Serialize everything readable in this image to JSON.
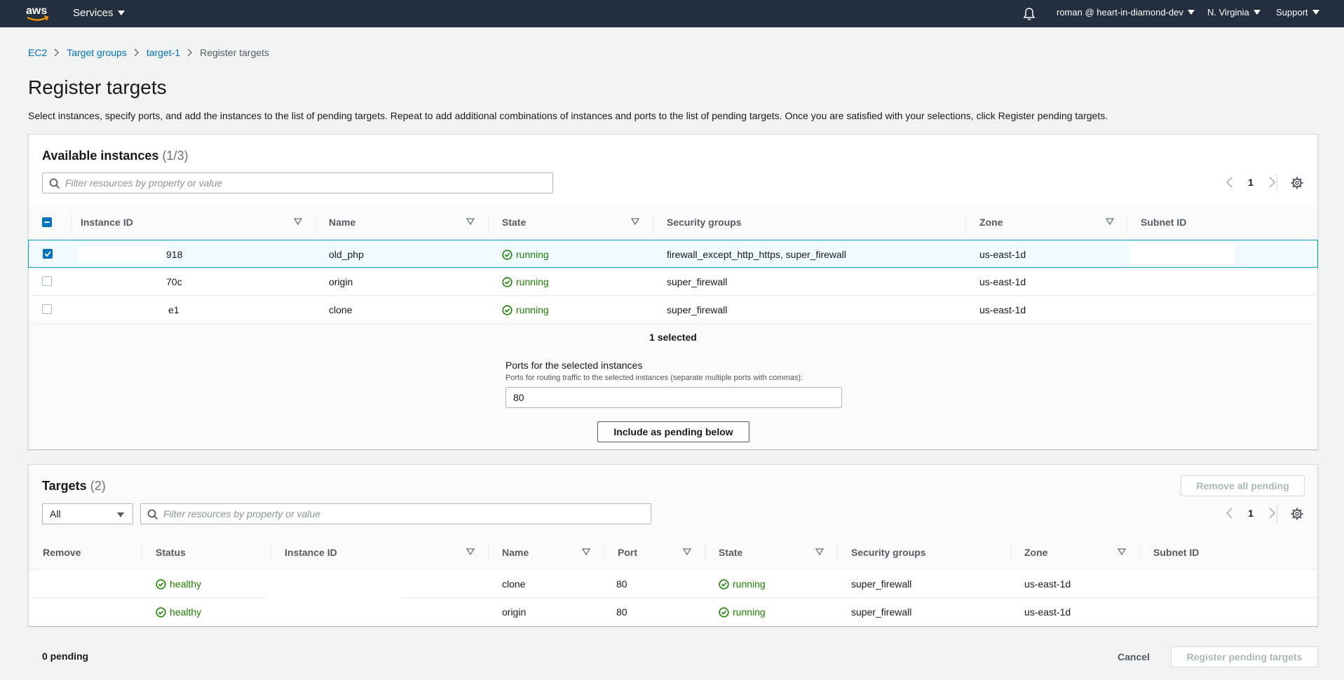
{
  "nav": {
    "services": "Services",
    "account": "roman @ heart-in-diamond-dev",
    "region": "N. Virginia",
    "support": "Support"
  },
  "breadcrumb": [
    "EC2",
    "Target groups",
    "target-1",
    "Register targets"
  ],
  "page": {
    "title": "Register targets",
    "description": "Select instances, specify ports, and add the instances to the list of pending targets. Repeat to add additional combinations of instances and ports to the list of pending targets. Once you are satisfied with your selections, click Register pending targets."
  },
  "available": {
    "title": "Available instances",
    "count": "(1/3)",
    "filter_placeholder": "Filter resources by property or value",
    "page": "1",
    "columns": [
      "Instance ID",
      "Name",
      "State",
      "Security groups",
      "Zone",
      "Subnet ID"
    ],
    "rows": [
      {
        "id": "918",
        "name": "old_php",
        "state": "running",
        "sg": "firewall_except_http_https, super_firewall",
        "zone": "us-east-1d",
        "checked": true
      },
      {
        "id": "70c",
        "name": "origin",
        "state": "running",
        "sg": "super_firewall",
        "zone": "us-east-1d",
        "checked": false
      },
      {
        "id": "e1",
        "name": "clone",
        "state": "running",
        "sg": "super_firewall",
        "zone": "us-east-1d",
        "checked": false
      }
    ],
    "selected_text": "1 selected",
    "ports_label": "Ports for the selected instances",
    "ports_hint": "Ports for routing traffic to the selected instances (separate multiple ports with commas):",
    "ports_value": "80",
    "include_button": "Include as pending below"
  },
  "targets": {
    "title": "Targets",
    "count": "(2)",
    "remove_all": "Remove all pending",
    "filter_select": "All",
    "filter_placeholder": "Filter resources by property or value",
    "page": "1",
    "columns": [
      "Remove",
      "Status",
      "Instance ID",
      "Name",
      "Port",
      "State",
      "Security groups",
      "Zone",
      "Subnet ID"
    ],
    "rows": [
      {
        "status": "healthy",
        "name": "clone",
        "port": "80",
        "state": "running",
        "sg": "super_firewall",
        "zone": "us-east-1d"
      },
      {
        "status": "healthy",
        "name": "origin",
        "port": "80",
        "state": "running",
        "sg": "super_firewall",
        "zone": "us-east-1d"
      }
    ]
  },
  "footer": {
    "pending": "0 pending",
    "cancel": "Cancel",
    "register": "Register pending targets"
  },
  "colors": {
    "nav_bg": "#232f3e",
    "link": "#0073bb",
    "success": "#1d8102",
    "selection_border": "#00a1c9"
  },
  "icons": [
    "aws-logo-icon",
    "caret-down-icon",
    "bell-icon",
    "chevron-right-icon",
    "search-icon",
    "chevron-left-icon",
    "gear-icon",
    "sort-icon",
    "check-circle-icon",
    "checkbox-icon"
  ]
}
